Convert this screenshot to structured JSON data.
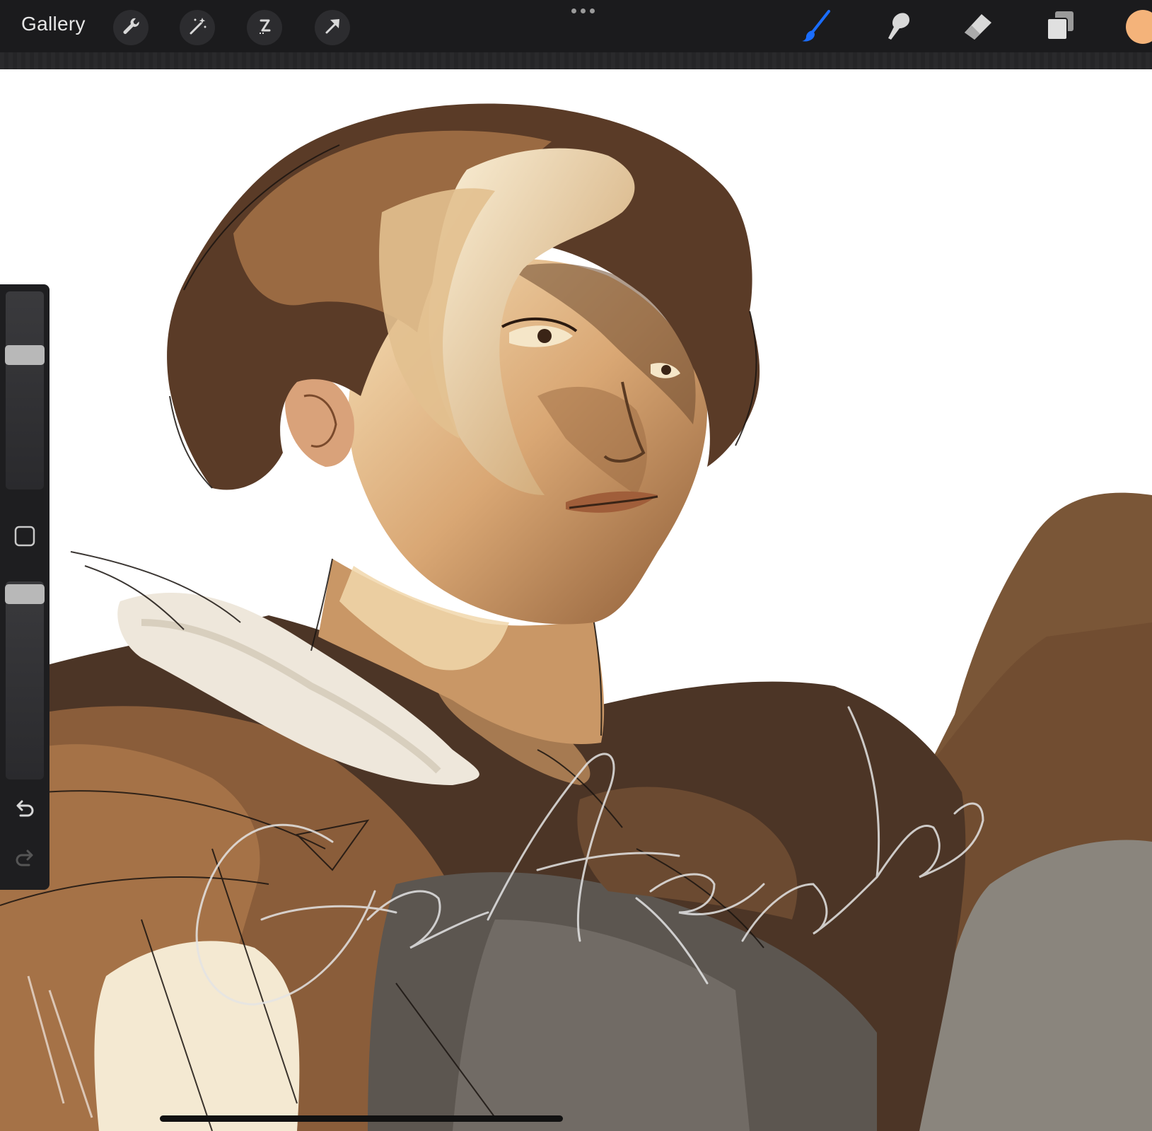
{
  "toolbar": {
    "gallery_label": "Gallery",
    "left_tools": [
      "wrench-icon",
      "magic-wand-icon",
      "selection-icon",
      "transform-arrow-icon"
    ],
    "more_menu": "more-dots-icon",
    "right_tools": [
      "brush-icon",
      "smudge-icon",
      "eraser-icon",
      "layers-icon"
    ],
    "active_tool": "brush-icon",
    "active_color": "#f4b37a",
    "accent_color": "#1a6dff"
  },
  "sidebar": {
    "size_slider_level": 0.7,
    "opacity_slider_level": 1.0,
    "modifier": "square-modifier-icon",
    "undo": "undo-icon",
    "redo": "redo-icon"
  },
  "canvas": {
    "content": "painted-portrait-artwork",
    "signature": "handwritten-signature"
  }
}
